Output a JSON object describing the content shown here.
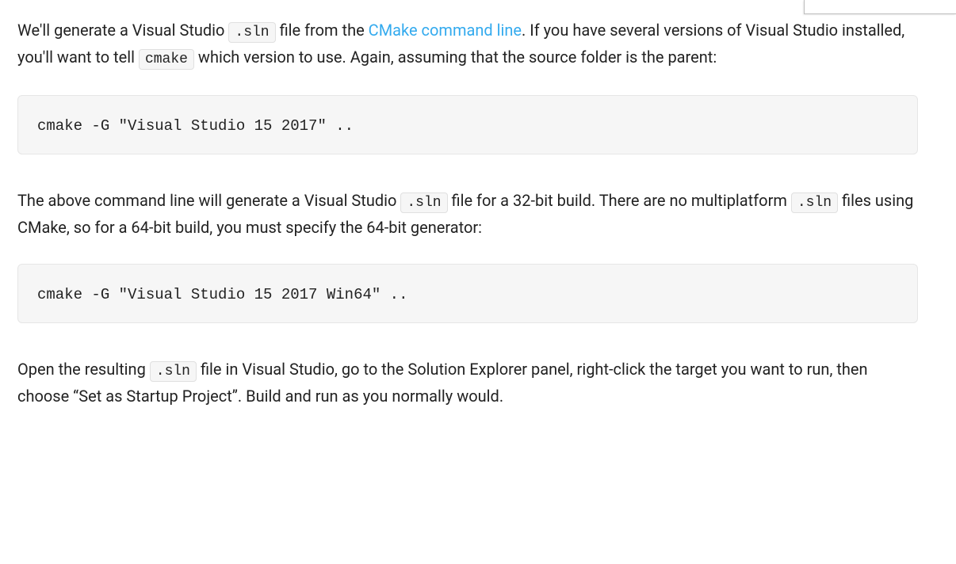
{
  "p1": {
    "t1": "We'll generate a Visual Studio ",
    "code1": ".sln",
    "t2": " file from the ",
    "link": "CMake command line",
    "t3": ". If you have several versions of Visual Studio installed, you'll want to tell ",
    "code2": "cmake",
    "t4": " which version to use. Again, assuming that the source folder is the parent:"
  },
  "codeblock1": "cmake -G \"Visual Studio 15 2017\" ..",
  "p2": {
    "t1": "The above command line will generate a Visual Studio ",
    "code1": ".sln",
    "t2": " file for a 32-bit build. There are no multiplatform ",
    "code2": ".sln",
    "t3": " files using CMake, so for a 64-bit build, you must specify the 64-bit generator:"
  },
  "codeblock2": "cmake -G \"Visual Studio 15 2017 Win64\" ..",
  "p3": {
    "t1": "Open the resulting ",
    "code1": ".sln",
    "t2": " file in Visual Studio, go to the Solution Explorer panel, right-click the target you want to run, then choose “Set as Startup Project”. Build and run as you normally would."
  }
}
